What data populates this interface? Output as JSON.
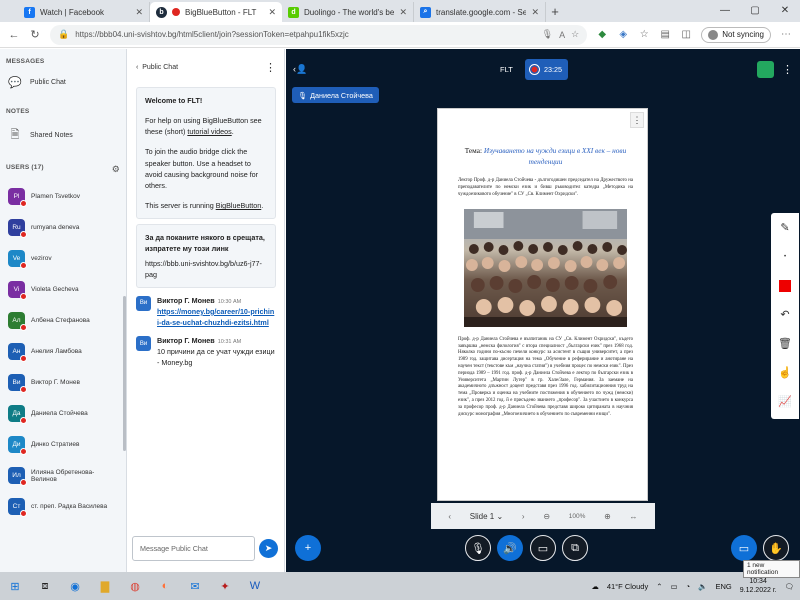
{
  "browser": {
    "tabs": [
      {
        "title": "Watch | Facebook",
        "icon": "facebook-icon",
        "color": "#1877f2",
        "glyph": "f"
      },
      {
        "title": "BigBlueButton - FLT",
        "icon": "bigbluebutton-icon",
        "color": "#1f2d3d",
        "glyph": "b"
      },
      {
        "title": "Duolingo - The world's best way",
        "icon": "duolingo-icon",
        "color": "#58cc02",
        "glyph": "d"
      },
      {
        "title": "translate.google.com - Search",
        "icon": "search-icon",
        "color": "#1a73e8",
        "glyph": "⌕"
      }
    ],
    "url": "https://bbb04.uni-svishtov.bg/html5client/join?sessionToken=etpahpu1fik5xzjc",
    "sync_label": "Not syncing"
  },
  "sidebar": {
    "messages_header": "MESSAGES",
    "public_chat": "Public Chat",
    "notes_header": "NOTES",
    "shared_notes": "Shared Notes",
    "users_header": "USERS (17)",
    "users": [
      {
        "initials": "Pl",
        "name": "Plamen Tsvetkov",
        "color": "#7a2ea2"
      },
      {
        "initials": "Ru",
        "name": "rumyana deneva",
        "color": "#2f3f9e"
      },
      {
        "initials": "Ve",
        "name": "vezirov",
        "color": "#1d88c7"
      },
      {
        "initials": "Vi",
        "name": "Violeta Gecheva",
        "color": "#7a2ea2"
      },
      {
        "initials": "Ал",
        "name": "Албена Стефанова",
        "color": "#2d7d32"
      },
      {
        "initials": "Ан",
        "name": "Анелия Ламбова",
        "color": "#1d5fb4"
      },
      {
        "initials": "Ви",
        "name": "Виктор Г. Монев",
        "color": "#1d5fb4"
      },
      {
        "initials": "Да",
        "name": "Даниела Стойчева",
        "color": "#0e7c86"
      },
      {
        "initials": "Ди",
        "name": "Динко Стратиев",
        "color": "#1d88c7"
      },
      {
        "initials": "Ил",
        "name": "Илияна Обретенова-Велинов",
        "color": "#1d5fb4"
      },
      {
        "initials": "Ст",
        "name": "ст. преп. Радка Василева",
        "color": "#1d5fb4"
      }
    ]
  },
  "chat": {
    "title": "Public Chat",
    "welcome_title": "Welcome to FLT!",
    "welcome_p1_pre": "For help on using BigBlueButton see these (short) ",
    "welcome_link": "tutorial videos",
    "welcome_p1_post": ".",
    "welcome_p2": "To join the audio bridge click the speaker button. Use a headset to avoid causing background noise for others.",
    "welcome_p3_pre": "This server is running ",
    "welcome_p3_link": "BigBlueButton",
    "welcome_p3_post": ".",
    "invite_title": "За да поканите някого в срещата, изпратете му този линк",
    "invite_link": "https://bbb.uni-svishtov.bg/b/uz6-j77-pag",
    "messages": [
      {
        "initials": "Ви",
        "name": "Виктор Г. Монев",
        "time": "10:30 AM",
        "text": "https://money.bg/career/10-prichini-da-se-uchat-chuzhdi-ezitsi.html",
        "is_link": true
      },
      {
        "initials": "Ви",
        "name": "Виктор Г. Монев",
        "time": "10:31 AM",
        "text": "10 причини да се учат чужди езици - Money.bg",
        "is_link": false
      }
    ],
    "input_placeholder": "Message Public Chat"
  },
  "presentation": {
    "title": "FLT",
    "recording_time": "23:25",
    "presenter_name": "Даниела Стойчева",
    "slide": {
      "title_prefix": "Тема: ",
      "title_main": "Изучаването на чужди езици в XXI век – нови тенденции",
      "intro": "Лектор Проф. д-р Даниела Стойчева - дългогодишен председател на Дружеството на преподавателите по немски език и бивш ръководител катедра „Методика на чуждоезиковото обучение\" в СУ „Св. Климент Охридски\".",
      "body": "Проф. д-р Даниела Стойчева е възпитаник на СУ „Св. Климент Охридски\", където завършва „немска филология\" с втора специалност „български език\" през 1968 год. Няколко години по-късно печели конкурс за асистент в същия университет, а през 1989 год. защитава дисертация на тема „Обучение в реферирание и анотиране на научен текст (текстове към „научна статия\") в учебния процес по немски език\". През периода 1989 – 1991 год. проф. д-р Даниела Стойчева е лектор по български език в Университета „Мартин Лутер\" в гр. Хале/Зале, Германия. За заемане на академичното длъжност доцент представя през 1996 год. хабилитационния труд на тема „Проверка и оценка на учебните постижения в обучението по чужд (немски) език\", а през 2012 год. й е присъдено званието „професор\". За участието в конкурса за професор проф. д-р Даниела Стойчева представя широко цитираната в научния дискурс монография „Многоезичието в обучението по съвременни езици\"."
    },
    "nav": {
      "slide_label": "Slide 1",
      "zoom": "100%"
    }
  },
  "notification": "1 new notification",
  "taskbar": {
    "weather": "41°F  Cloudy",
    "lang": "ENG",
    "time": "10:34",
    "date": "9.12.2022 г."
  }
}
